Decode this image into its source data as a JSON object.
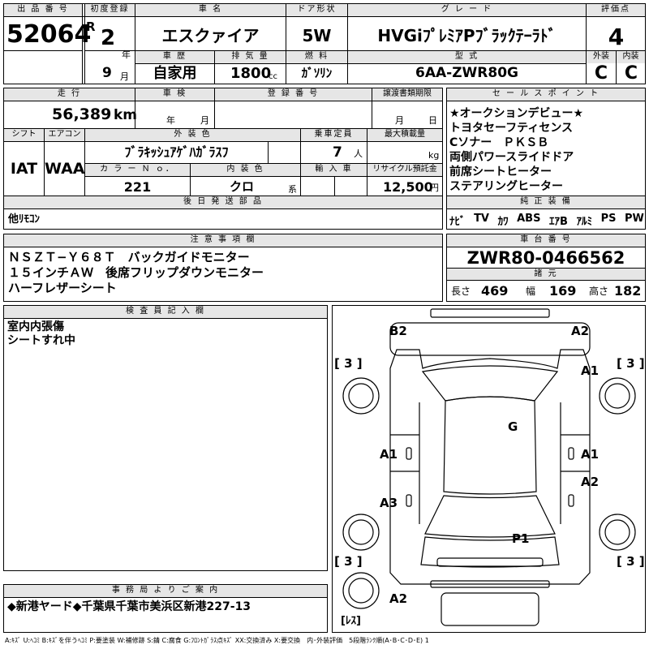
{
  "header": {
    "lot_label": "出 品 番 号",
    "lot_no": "52064",
    "first_reg_label": "初度登録",
    "era": "R",
    "year": "2",
    "year_unit": "年",
    "month": "9",
    "month_unit": "月",
    "car_name_label": "車 名",
    "car_name": "エスクァイア",
    "door_label": "ドア形状",
    "door": "5W",
    "grade_label": "グ レ ー ド",
    "grade": "HVGiﾌﾟﾚﾐｱPﾌﾞﾗｯｸﾃｰﾗﾄﾞ",
    "score_label": "評価点",
    "score": "4",
    "history_label": "車 歴",
    "history": "自家用",
    "displacement_label": "排 気 量",
    "displacement": "1800",
    "displacement_unit": "cc",
    "fuel_label": "燃 料",
    "fuel": "ｶﾞｿﾘﾝ",
    "model_label": "型 式",
    "model": "6AA-ZWR80G",
    "exterior_label": "外装",
    "exterior": "C",
    "interior_label": "内装",
    "interior": "C"
  },
  "details": {
    "mileage_label": "走 行",
    "mileage": "56,389",
    "mileage_unit": "km",
    "inspection_label": "車 検",
    "insp_year_unit": "年",
    "insp_month_unit": "月",
    "plate_label": "登 録 番 号",
    "transfer_label": "譲渡書類期限",
    "transfer_month_unit": "月",
    "transfer_day_unit": "日",
    "shift_label": "シフト",
    "shift": "IAT",
    "ac_label": "エアコン",
    "ac": "WAA",
    "color_label": "外 装 色",
    "color": "ﾌﾞﾗｷｯｼｭｱｹﾞﾊｶﾞﾗｽﾌ",
    "capacity_label": "乗車定員",
    "capacity": "7",
    "capacity_unit": "人",
    "load_label": "最大積載量",
    "load_unit": "kg",
    "color_no_label": "カ ラ ー Ｎ ｏ．",
    "color_no": "221",
    "int_color_label": "内 装 色",
    "int_color": "クロ",
    "int_color_unit": "系",
    "import_label": "輸 入 車",
    "recycle_label": "リサイクル預託金",
    "recycle": "12,500",
    "recycle_unit": "円",
    "later_label": "後 日 発 送 部 品",
    "later": "他ﾘﾓｺﾝ"
  },
  "sales_points": {
    "label": "セ ー ル ス ポ イ ン ト",
    "items": [
      "★オークションデビュー★",
      "トヨタセーフティセンス",
      "Cソナー　ＰＫＳＢ",
      "両側パワースライドドア",
      "前席シートヒーター",
      "ステアリングヒーター"
    ]
  },
  "equipment": {
    "label": "純 正 装 備",
    "items": [
      "ﾅﾋﾞ",
      "TV",
      "ｶﾜ",
      "ABS",
      "ｴｱB",
      "ｱﾙﾐ",
      "PS",
      "PW"
    ]
  },
  "notes": {
    "label": "注 意 事 項 欄",
    "lines": [
      "ＮＳＺＴ−Ｙ６８Ｔ　バックガイドモニター",
      "１５インチＡＷ　後席フリップダウンモニター",
      "ハーフレザーシート"
    ]
  },
  "chassis": {
    "label": "車 台 番 号",
    "number": "ZWR80-0466562",
    "spec_label": "諸 元",
    "length_label": "長さ",
    "length": "469",
    "width_label": "幅",
    "width": "169",
    "height_label": "高さ",
    "height": "182"
  },
  "inspector": {
    "label": "検 査 員 記 入 欄",
    "lines": [
      "室内内張傷",
      "シートすれ中"
    ]
  },
  "diagram": {
    "marks": {
      "b2": "B2",
      "a2_top": "A2",
      "a1_right_front": "A1",
      "g": "G",
      "a1_left_door": "A1",
      "a1_right_door": "A1",
      "a2_right_rear": "A2",
      "a3_left_rear": "A3",
      "p1": "P1",
      "a2_bottom": "A2"
    },
    "tires": {
      "fl": "[ 3 ]",
      "fr": "[ 3 ]",
      "rl": "[ 3 ]",
      "rr": "[ 3 ]",
      "spare": "[ﾚｽ]"
    }
  },
  "office": {
    "label": "事 務 局 よ り ご 案 内",
    "text": "◆新港ヤード◆千葉県千葉市美浜区新港227-13"
  },
  "legend": "A:ｷｽﾞ U:ﾍｺﾐ B:ｷｽﾞを伴うﾍｺﾐ P:要塗装 W:補修跡 S:錆 C:腐食 G:ﾌﾛﾝﾄｶﾞﾗｽ点ｷｽﾞ XX:交換済み X:要交換　内･外装評価　5段階ﾗﾝｸ順(A･B･C･D･E) 1"
}
